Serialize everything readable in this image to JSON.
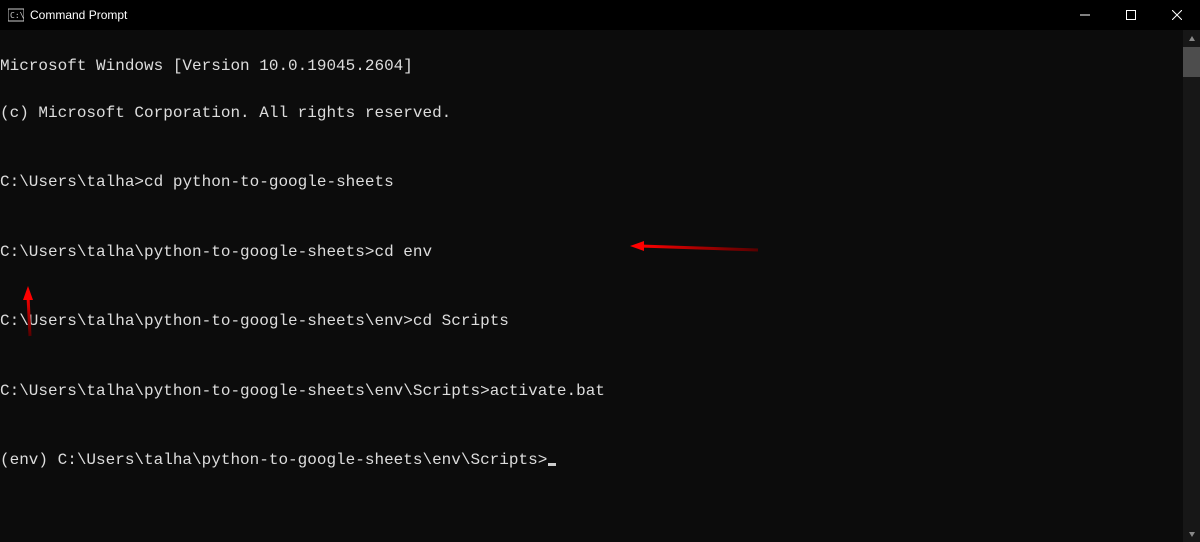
{
  "window": {
    "title": "Command Prompt"
  },
  "terminal": {
    "line1": "Microsoft Windows [Version 10.0.19045.2604]",
    "line2": "(c) Microsoft Corporation. All rights reserved.",
    "blank1": "",
    "prompt1": "C:\\Users\\talha>",
    "cmd1": "cd python-to-google-sheets",
    "blank2": "",
    "prompt2": "C:\\Users\\talha\\python-to-google-sheets>",
    "cmd2": "cd env",
    "blank3": "",
    "prompt3": "C:\\Users\\talha\\python-to-google-sheets\\env>",
    "cmd3": "cd Scripts",
    "blank4": "",
    "prompt4": "C:\\Users\\talha\\python-to-google-sheets\\env\\Scripts>",
    "cmd4": "activate.bat",
    "blank5": "",
    "prompt5": "(env) C:\\Users\\talha\\python-to-google-sheets\\env\\Scripts>",
    "cmd5": ""
  }
}
